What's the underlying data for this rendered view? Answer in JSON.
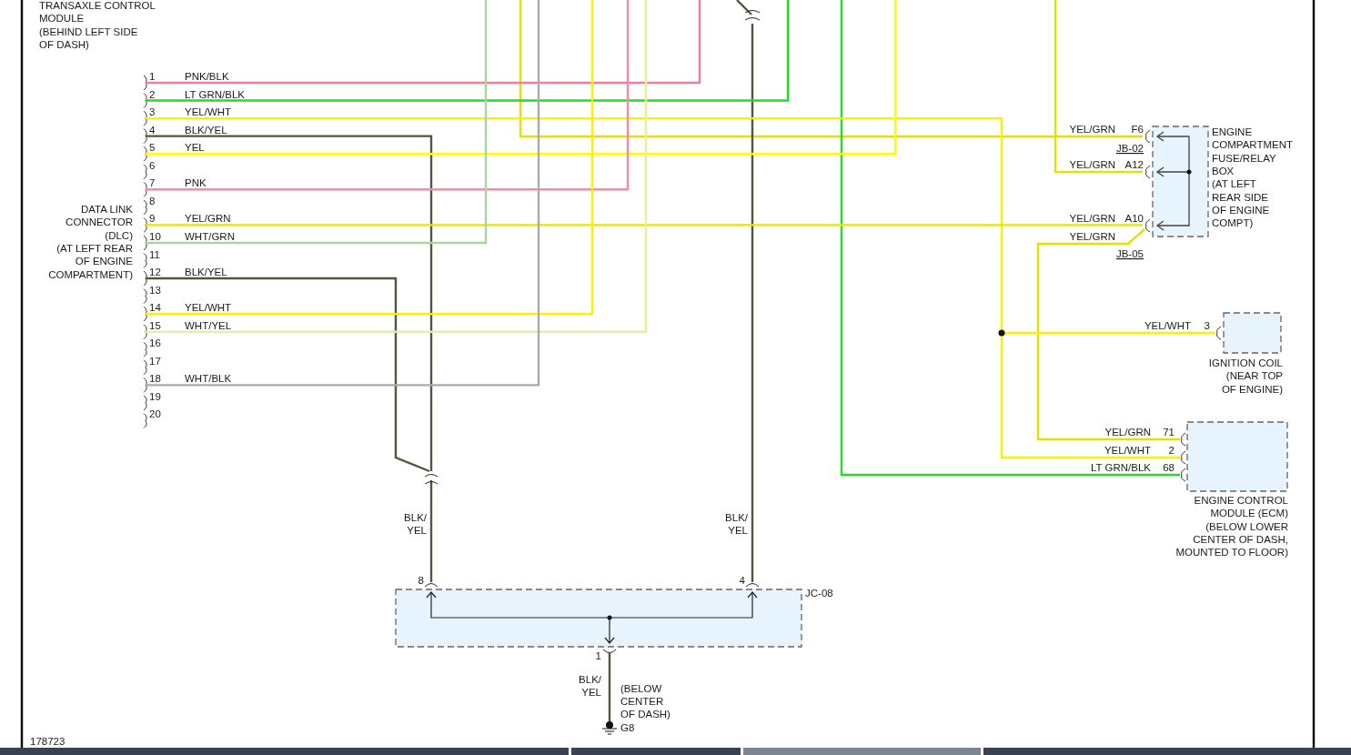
{
  "transaxle_module": {
    "label_lines": [
      "TRANSAXLE CONTROL",
      "MODULE",
      "(BEHIND LEFT SIDE",
      "OF DASH)"
    ]
  },
  "dlc": {
    "label_lines": [
      "DATA LINK",
      "CONNECTOR",
      "(DLC)",
      "(AT LEFT REAR",
      "OF ENGINE",
      "COMPARTMENT)"
    ],
    "pins": [
      {
        "number": "1",
        "wire": "PNK/BLK"
      },
      {
        "number": "2",
        "wire": "LT GRN/BLK"
      },
      {
        "number": "3",
        "wire": "YEL/WHT"
      },
      {
        "number": "4",
        "wire": "BLK/YEL"
      },
      {
        "number": "5",
        "wire": "YEL"
      },
      {
        "number": "6"
      },
      {
        "number": "7",
        "wire": "PNK"
      },
      {
        "number": "8"
      },
      {
        "number": "9",
        "wire": "YEL/GRN"
      },
      {
        "number": "10",
        "wire": "WHT/GRN"
      },
      {
        "number": "11"
      },
      {
        "number": "12",
        "wire": "BLK/YEL"
      },
      {
        "number": "13"
      },
      {
        "number": "14",
        "wire": "YEL/WHT"
      },
      {
        "number": "15",
        "wire": "WHT/YEL"
      },
      {
        "number": "16"
      },
      {
        "number": "17"
      },
      {
        "number": "18",
        "wire": "WHT/BLK"
      },
      {
        "number": "19"
      },
      {
        "number": "20"
      }
    ]
  },
  "fuse_relay_box": {
    "label_lines": [
      "ENGINE",
      "COMPARTMENT",
      "FUSE/RELAY",
      "BOX",
      "(AT LEFT",
      "REAR SIDE",
      "OF ENGINE",
      "COMPT)"
    ],
    "pins": [
      {
        "wire": "YEL/GRN",
        "pin": "F6"
      },
      {
        "wire": "YEL/GRN",
        "pin": "A12"
      },
      {
        "wire": "YEL/GRN",
        "pin": "A10"
      }
    ],
    "connectors": [
      "JB-02",
      "JB-05"
    ],
    "jb05_wire": "YEL/GRN"
  },
  "ignition_coil": {
    "label_lines": [
      "IGNITION COIL",
      "(NEAR TOP",
      "OF ENGINE)"
    ],
    "wire": "YEL/WHT",
    "pin": "3"
  },
  "ecm": {
    "label_lines": [
      "ENGINE CONTROL",
      "MODULE (ECM)",
      "(BELOW LOWER",
      "CENTER OF DASH,",
      "MOUNTED TO FLOOR)"
    ],
    "pins": [
      {
        "wire": "YEL/GRN",
        "pin": "71"
      },
      {
        "wire": "YEL/WHT",
        "pin": "2"
      },
      {
        "wire": "LT GRN/BLK",
        "pin": "68"
      }
    ]
  },
  "joint_connector": {
    "name": "JC-08",
    "pins": [
      "8",
      "4",
      "1"
    ],
    "wire_labels": [
      [
        "BLK/",
        "YEL"
      ],
      [
        "BLK/",
        "YEL"
      ],
      [
        "BLK/",
        "YEL"
      ]
    ]
  },
  "ground": {
    "name": "G8",
    "location_lines": [
      "(BELOW",
      "CENTER",
      "OF DASH)"
    ]
  },
  "figure_number": "178723",
  "bottom_bar": {
    "segments": [
      {
        "selected": false
      },
      {
        "selected": false
      },
      {
        "selected": true
      },
      {
        "selected": false
      }
    ]
  }
}
